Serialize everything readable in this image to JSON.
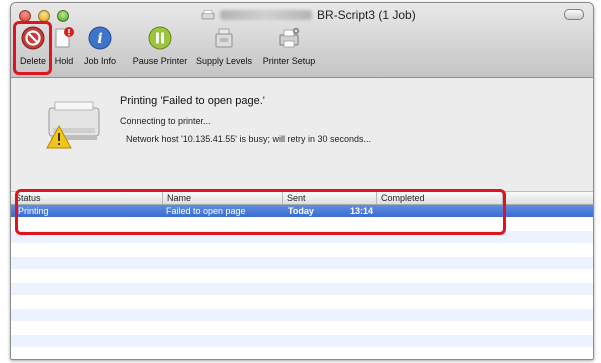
{
  "window": {
    "title": "BR-Script3 (1 Job)",
    "colors": {
      "accent_selection": "#3a6cd2",
      "highlight_box": "#e0141e"
    }
  },
  "toolbar": {
    "items": [
      {
        "label": "Delete",
        "icon": "delete-icon"
      },
      {
        "label": "Hold",
        "icon": "hold-icon"
      },
      {
        "label": "Job Info",
        "icon": "info-icon"
      },
      {
        "label": "Pause Printer",
        "icon": "pause-printer-icon"
      },
      {
        "label": "Supply Levels",
        "icon": "supply-levels-icon"
      },
      {
        "label": "Printer Setup",
        "icon": "printer-setup-icon"
      }
    ]
  },
  "status": {
    "title": "Printing 'Failed to open page.'",
    "line2": "Connecting to printer...",
    "line3": "Network host '10.135.41.55' is busy; will retry in 30 seconds..."
  },
  "jobs": {
    "columns": [
      "Status",
      "Name",
      "Sent",
      "Completed"
    ],
    "rows": [
      {
        "status": "Printing",
        "name": "Failed to open page",
        "sent_day": "Today",
        "sent_time": "13:14",
        "completed": ""
      }
    ]
  }
}
